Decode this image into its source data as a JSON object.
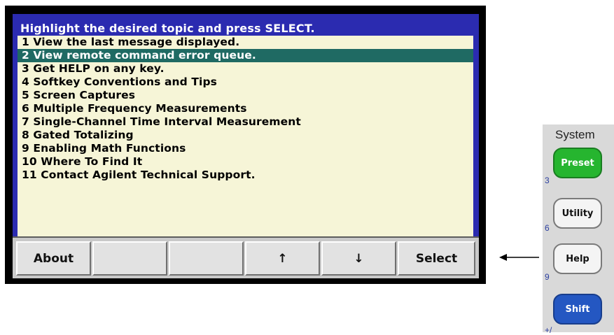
{
  "screen": {
    "title": "Highlight the desired topic and press SELECT.",
    "items": [
      "1 View the last message displayed.",
      "2 View remote command error queue.",
      "3 Get HELP on any key.",
      "4 Softkey Conventions and Tips",
      "5 Screen Captures",
      "6 Multiple Frequency Measurements",
      "7 Single-Channel Time Interval Measurement",
      "8 Gated Totalizing",
      "9 Enabling Math Functions",
      "10 Where To Find It",
      "11 Contact Agilent Technical Support."
    ],
    "selected_index": 1,
    "softkeys": [
      "About",
      "",
      "",
      "↑",
      "↓",
      "Select"
    ]
  },
  "panel": {
    "title": "System",
    "buttons": [
      {
        "label": "Preset",
        "color": "#26b52f",
        "number": "3"
      },
      {
        "label": "Utility",
        "color": "#f4f4f4",
        "number": "6"
      },
      {
        "label": "Help",
        "color": "#f4f4f4",
        "number": "9"
      },
      {
        "label": "Shift",
        "color": "#2457c2",
        "number": "+/"
      }
    ]
  },
  "colors": {
    "screen_bg": "#2b2bb0",
    "list_bg": "#f6f5d7",
    "highlight": "#1f6a63"
  }
}
